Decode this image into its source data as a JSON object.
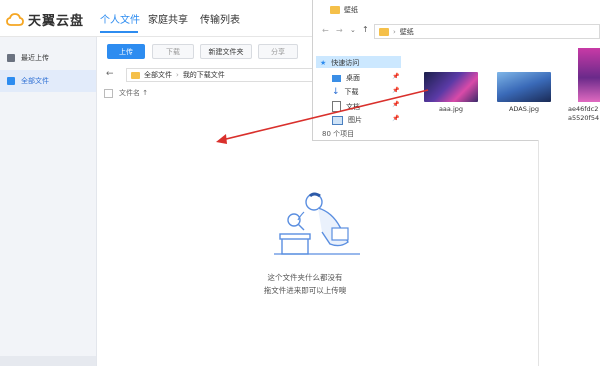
{
  "app": {
    "brand": "天翼云盘",
    "tabs": [
      "个人文件",
      "家庭共享",
      "传输列表"
    ],
    "active_tab": 0
  },
  "sidebar": {
    "items": [
      {
        "label": "最近上传",
        "icon": "clock-icon"
      },
      {
        "label": "全部文件",
        "icon": "folder-icon",
        "active": true
      }
    ]
  },
  "toolbar": {
    "upload": "上传",
    "download": "下载",
    "new_folder": "新建文件夹",
    "share": "分享"
  },
  "path": {
    "segments": [
      "全部文件",
      "我的下载文件"
    ]
  },
  "list": {
    "column_name": "文件名 ↑"
  },
  "empty": {
    "line1": "这个文件夹什么都没有",
    "line2": "拖文件进来即可以上传噢"
  },
  "explorer": {
    "title": "壁纸",
    "address": "壁纸",
    "quick_access": "快速访问",
    "nav": [
      {
        "label": "桌面",
        "icon": "desktop-icon"
      },
      {
        "label": "下载",
        "icon": "download-icon"
      },
      {
        "label": "文档",
        "icon": "document-icon"
      },
      {
        "label": "图片",
        "icon": "picture-icon"
      }
    ],
    "item_count": "80 个项目",
    "files": [
      {
        "name": "aaa.jpg"
      },
      {
        "name": "ADAS.jpg"
      },
      {
        "name": "ae46fdc2",
        "name2": "a5520f54"
      }
    ]
  },
  "colors": {
    "accent": "#2d8cf0",
    "sidebar_bg": "#f2f4f8",
    "arrow": "#d9302c"
  }
}
